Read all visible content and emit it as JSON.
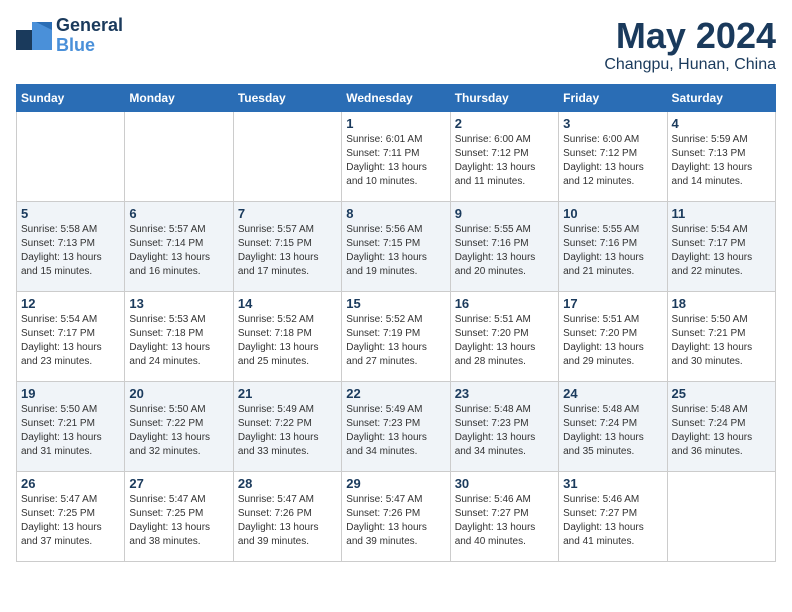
{
  "logo": {
    "brand": "General",
    "brand_accent": "Blue",
    "tagline": ""
  },
  "header": {
    "month": "May 2024",
    "location": "Changpu, Hunan, China"
  },
  "days_of_week": [
    "Sunday",
    "Monday",
    "Tuesday",
    "Wednesday",
    "Thursday",
    "Friday",
    "Saturday"
  ],
  "weeks": [
    [
      {
        "day": "",
        "info": ""
      },
      {
        "day": "",
        "info": ""
      },
      {
        "day": "",
        "info": ""
      },
      {
        "day": "1",
        "info": "Sunrise: 6:01 AM\nSunset: 7:11 PM\nDaylight: 13 hours\nand 10 minutes."
      },
      {
        "day": "2",
        "info": "Sunrise: 6:00 AM\nSunset: 7:12 PM\nDaylight: 13 hours\nand 11 minutes."
      },
      {
        "day": "3",
        "info": "Sunrise: 6:00 AM\nSunset: 7:12 PM\nDaylight: 13 hours\nand 12 minutes."
      },
      {
        "day": "4",
        "info": "Sunrise: 5:59 AM\nSunset: 7:13 PM\nDaylight: 13 hours\nand 14 minutes."
      }
    ],
    [
      {
        "day": "5",
        "info": "Sunrise: 5:58 AM\nSunset: 7:13 PM\nDaylight: 13 hours\nand 15 minutes."
      },
      {
        "day": "6",
        "info": "Sunrise: 5:57 AM\nSunset: 7:14 PM\nDaylight: 13 hours\nand 16 minutes."
      },
      {
        "day": "7",
        "info": "Sunrise: 5:57 AM\nSunset: 7:15 PM\nDaylight: 13 hours\nand 17 minutes."
      },
      {
        "day": "8",
        "info": "Sunrise: 5:56 AM\nSunset: 7:15 PM\nDaylight: 13 hours\nand 19 minutes."
      },
      {
        "day": "9",
        "info": "Sunrise: 5:55 AM\nSunset: 7:16 PM\nDaylight: 13 hours\nand 20 minutes."
      },
      {
        "day": "10",
        "info": "Sunrise: 5:55 AM\nSunset: 7:16 PM\nDaylight: 13 hours\nand 21 minutes."
      },
      {
        "day": "11",
        "info": "Sunrise: 5:54 AM\nSunset: 7:17 PM\nDaylight: 13 hours\nand 22 minutes."
      }
    ],
    [
      {
        "day": "12",
        "info": "Sunrise: 5:54 AM\nSunset: 7:17 PM\nDaylight: 13 hours\nand 23 minutes."
      },
      {
        "day": "13",
        "info": "Sunrise: 5:53 AM\nSunset: 7:18 PM\nDaylight: 13 hours\nand 24 minutes."
      },
      {
        "day": "14",
        "info": "Sunrise: 5:52 AM\nSunset: 7:18 PM\nDaylight: 13 hours\nand 25 minutes."
      },
      {
        "day": "15",
        "info": "Sunrise: 5:52 AM\nSunset: 7:19 PM\nDaylight: 13 hours\nand 27 minutes."
      },
      {
        "day": "16",
        "info": "Sunrise: 5:51 AM\nSunset: 7:20 PM\nDaylight: 13 hours\nand 28 minutes."
      },
      {
        "day": "17",
        "info": "Sunrise: 5:51 AM\nSunset: 7:20 PM\nDaylight: 13 hours\nand 29 minutes."
      },
      {
        "day": "18",
        "info": "Sunrise: 5:50 AM\nSunset: 7:21 PM\nDaylight: 13 hours\nand 30 minutes."
      }
    ],
    [
      {
        "day": "19",
        "info": "Sunrise: 5:50 AM\nSunset: 7:21 PM\nDaylight: 13 hours\nand 31 minutes."
      },
      {
        "day": "20",
        "info": "Sunrise: 5:50 AM\nSunset: 7:22 PM\nDaylight: 13 hours\nand 32 minutes."
      },
      {
        "day": "21",
        "info": "Sunrise: 5:49 AM\nSunset: 7:22 PM\nDaylight: 13 hours\nand 33 minutes."
      },
      {
        "day": "22",
        "info": "Sunrise: 5:49 AM\nSunset: 7:23 PM\nDaylight: 13 hours\nand 34 minutes."
      },
      {
        "day": "23",
        "info": "Sunrise: 5:48 AM\nSunset: 7:23 PM\nDaylight: 13 hours\nand 34 minutes."
      },
      {
        "day": "24",
        "info": "Sunrise: 5:48 AM\nSunset: 7:24 PM\nDaylight: 13 hours\nand 35 minutes."
      },
      {
        "day": "25",
        "info": "Sunrise: 5:48 AM\nSunset: 7:24 PM\nDaylight: 13 hours\nand 36 minutes."
      }
    ],
    [
      {
        "day": "26",
        "info": "Sunrise: 5:47 AM\nSunset: 7:25 PM\nDaylight: 13 hours\nand 37 minutes."
      },
      {
        "day": "27",
        "info": "Sunrise: 5:47 AM\nSunset: 7:25 PM\nDaylight: 13 hours\nand 38 minutes."
      },
      {
        "day": "28",
        "info": "Sunrise: 5:47 AM\nSunset: 7:26 PM\nDaylight: 13 hours\nand 39 minutes."
      },
      {
        "day": "29",
        "info": "Sunrise: 5:47 AM\nSunset: 7:26 PM\nDaylight: 13 hours\nand 39 minutes."
      },
      {
        "day": "30",
        "info": "Sunrise: 5:46 AM\nSunset: 7:27 PM\nDaylight: 13 hours\nand 40 minutes."
      },
      {
        "day": "31",
        "info": "Sunrise: 5:46 AM\nSunset: 7:27 PM\nDaylight: 13 hours\nand 41 minutes."
      },
      {
        "day": "",
        "info": ""
      }
    ]
  ]
}
